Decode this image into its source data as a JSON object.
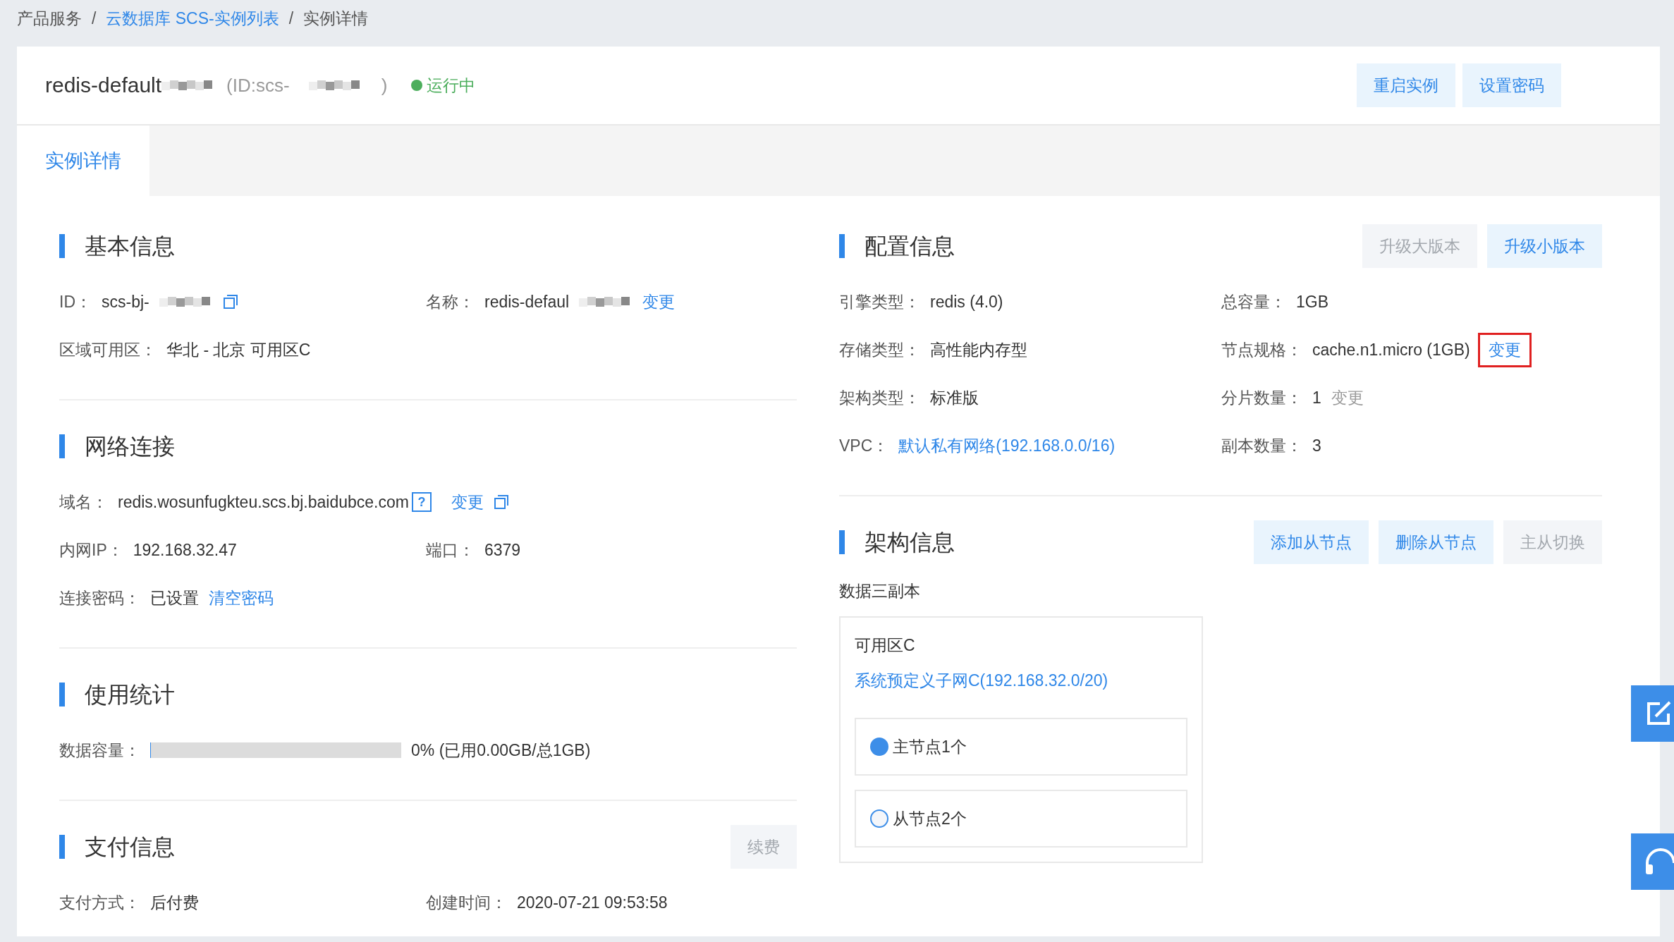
{
  "breadcrumb": [
    {
      "text": "产品服务",
      "link": false
    },
    {
      "text": "云数据库 SCS-实例列表",
      "link": true,
      "separator": "/"
    },
    {
      "text": "实例详情",
      "link": false,
      "separator": "/"
    }
  ],
  "header": {
    "name": "redis-default",
    "id_prefix": "(ID:scs-",
    "id_suffix": ")",
    "status": "运行中",
    "buttons": [
      "重启实例",
      "设置密码"
    ]
  },
  "tabs": [
    {
      "label": "实例详情",
      "selected": true
    }
  ],
  "left": [
    {
      "title": "基本信息",
      "rows": [
        [
          {
            "label": "ID：",
            "parts": [
              {
                "kind": "value",
                "text": "scs-bj-"
              },
              {
                "kind": "blur"
              },
              {
                "kind": "copy"
              }
            ]
          },
          {
            "label": "名称：",
            "parts": [
              {
                "kind": "value",
                "text": "redis-defaul"
              },
              {
                "kind": "blur"
              },
              {
                "kind": "link",
                "text": "变更"
              }
            ]
          }
        ],
        [
          {
            "label": "区域可用区：",
            "parts": [
              {
                "kind": "value",
                "text": "华北 - 北京 可用区C"
              }
            ]
          }
        ]
      ]
    },
    {
      "title": "网络连接",
      "rows": [
        [
          {
            "label": "域名：",
            "parts": [
              {
                "kind": "value",
                "text": "redis.wosunfugkteu.scs.bj.baidubce.com"
              },
              {
                "kind": "help",
                "text": "?"
              },
              {
                "kind": "link",
                "text": "变更"
              },
              {
                "kind": "copy"
              }
            ]
          }
        ],
        [
          {
            "label": "内网IP：",
            "parts": [
              {
                "kind": "value",
                "text": "192.168.32.47"
              }
            ]
          },
          {
            "label": "端口：",
            "parts": [
              {
                "kind": "value",
                "text": "6379"
              }
            ]
          }
        ],
        [
          {
            "label": "连接密码：",
            "parts": [
              {
                "kind": "value",
                "text": "已设置"
              },
              {
                "kind": "link",
                "text": "清空密码"
              }
            ]
          }
        ]
      ]
    },
    {
      "title": "使用统计",
      "rows": [
        [
          {
            "label": "数据容量：",
            "parts": [
              {
                "kind": "meter",
                "level": 0
              },
              {
                "kind": "value",
                "text": "0% (已用0.00GB/总1GB)"
              }
            ]
          }
        ]
      ]
    },
    {
      "title": "支付信息",
      "buttons": [
        {
          "label": "续费",
          "disabled": true
        }
      ],
      "rows": [
        [
          {
            "label": "支付方式：",
            "parts": [
              {
                "kind": "value",
                "text": "后付费"
              }
            ]
          },
          {
            "label": "创建时间：",
            "parts": [
              {
                "kind": "value",
                "text": "2020-07-21 09:53:58"
              }
            ]
          }
        ]
      ]
    }
  ],
  "right": [
    {
      "title": "配置信息",
      "buttons": [
        {
          "label": "升级大版本",
          "disabled": true
        },
        {
          "label": "升级小版本",
          "disabled": false
        }
      ],
      "rows": [
        [
          {
            "label": "引擎类型：",
            "parts": [
              {
                "kind": "value",
                "text": "redis (4.0)"
              }
            ]
          },
          {
            "label": "总容量：",
            "parts": [
              {
                "kind": "value",
                "text": "1GB"
              }
            ]
          }
        ],
        [
          {
            "label": "存储类型：",
            "parts": [
              {
                "kind": "value",
                "text": "高性能内存型"
              }
            ]
          },
          {
            "label": "节点规格：",
            "parts": [
              {
                "kind": "value",
                "text": "cache.n1.micro (1GB)"
              },
              {
                "kind": "link",
                "text": "变更",
                "highlighted": true
              }
            ]
          }
        ],
        [
          {
            "label": "架构类型：",
            "parts": [
              {
                "kind": "value",
                "text": "标准版"
              }
            ]
          },
          {
            "label": "分片数量：",
            "parts": [
              {
                "kind": "value",
                "text": "1"
              },
              {
                "kind": "disabled-link",
                "text": "变更"
              }
            ]
          }
        ],
        [
          {
            "label": "VPC：",
            "parts": [
              {
                "kind": "link",
                "text": "默认私有网络(192.168.0.0/16)"
              }
            ]
          },
          {
            "label": "副本数量：",
            "parts": [
              {
                "kind": "value",
                "text": "3"
              }
            ]
          }
        ]
      ]
    },
    {
      "title": "架构信息",
      "buttons": [
        {
          "label": "添加从节点",
          "disabled": false
        },
        {
          "label": "删除从节点",
          "disabled": false
        },
        {
          "label": "主从切换",
          "disabled": true
        }
      ],
      "subtitle": "数据三副本",
      "zone": {
        "title": "可用区C",
        "subnet": "系统预定义子网C(192.168.32.0/20)",
        "nodes": [
          {
            "label": "主节点1个",
            "kind": "master"
          },
          {
            "label": "从节点2个",
            "kind": "replica"
          }
        ]
      }
    }
  ]
}
